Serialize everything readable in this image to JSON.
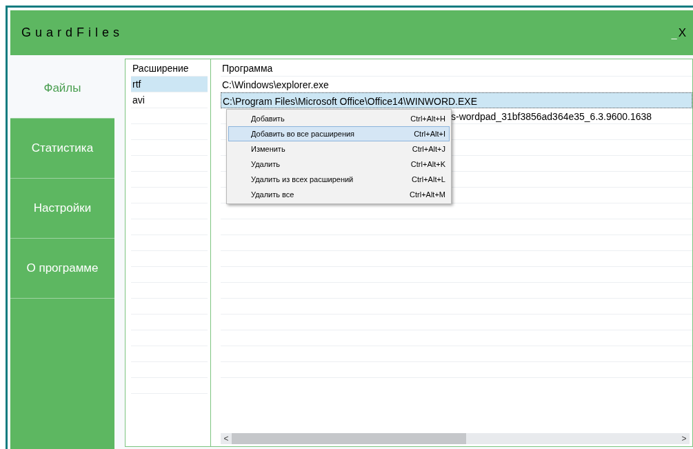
{
  "window": {
    "title": "GuardFiles",
    "minimize": "_",
    "close": "X"
  },
  "sidebar": {
    "items": [
      {
        "label": "Файлы",
        "selected": true
      },
      {
        "label": "Статистика",
        "selected": false
      },
      {
        "label": "Настройки",
        "selected": false
      },
      {
        "label": "О программе",
        "selected": false
      }
    ]
  },
  "extensions": {
    "header": "Расширение",
    "rows": [
      {
        "text": "rtf",
        "selected": true
      },
      {
        "text": "avi",
        "selected": false
      }
    ]
  },
  "programs": {
    "header": "Программа",
    "rows": [
      {
        "text": "C:\\Windows\\explorer.exe",
        "selected": false,
        "covered": false
      },
      {
        "text": "C:\\Program Files\\Microsoft Office\\Office14\\WINWORD.EXE",
        "selected": true,
        "covered": false
      },
      {
        "text": "s-wordpad_31bf3856ad364e35_6.3.9600.1638",
        "selected": false,
        "covered": true
      }
    ]
  },
  "context_menu": {
    "items": [
      {
        "label": "Добавить",
        "shortcut": "Ctrl+Alt+H",
        "selected": false
      },
      {
        "label": "Добавить во все расширения",
        "shortcut": "Ctrl+Alt+I",
        "selected": true
      },
      {
        "label": "Изменить",
        "shortcut": "Ctrl+Alt+J",
        "selected": false
      },
      {
        "label": "Удалить",
        "shortcut": "Ctrl+Alt+K",
        "selected": false
      },
      {
        "label": "Удалить из всех расширений",
        "shortcut": "Ctrl+Alt+L",
        "selected": false
      },
      {
        "label": "Удалить все",
        "shortcut": "Ctrl+Alt+M",
        "selected": false
      }
    ]
  },
  "scroll_left": "<",
  "scroll_right": ">"
}
